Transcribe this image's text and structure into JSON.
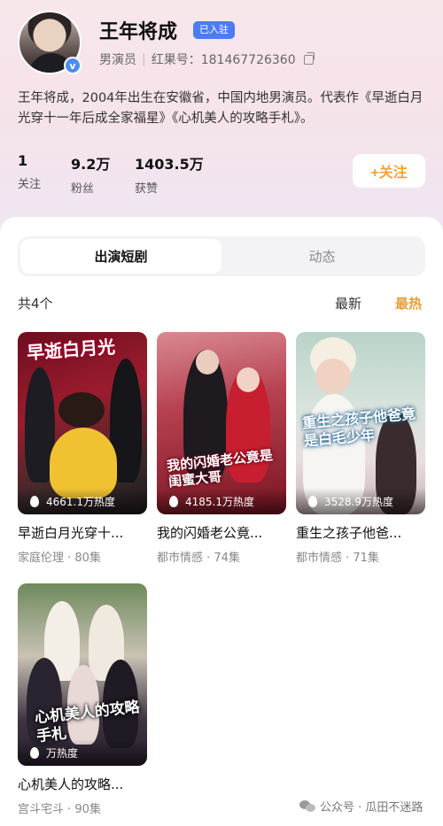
{
  "profile": {
    "name": "王年将成",
    "badge": "已入驻",
    "role": "男演员",
    "id_label": "红果号：181467726360",
    "bio": "王年将成，2004年出生在安徽省，中国内地男演员。代表作《早逝白月光穿十一年后成全家福星》《心机美人的攻略手札》。",
    "verified_mark": "v"
  },
  "stats": [
    {
      "value": "1",
      "label": "关注"
    },
    {
      "value": "9.2万",
      "label": "粉丝"
    },
    {
      "value": "1403.5万",
      "label": "获赞"
    }
  ],
  "follow_label": "+关注",
  "tabs": [
    {
      "label": "出演短剧",
      "active": true
    },
    {
      "label": "动态",
      "active": false
    }
  ],
  "list": {
    "count_label": "共4个",
    "sort_newest": "最新",
    "sort_hottest": "最热",
    "accent_color": "#e6a03c"
  },
  "dramas": [
    {
      "poster_text": "早逝白月光",
      "heat": "4661.1万热度",
      "title": "早逝白月光穿十...",
      "meta": "家庭伦理 · 80集"
    },
    {
      "poster_text": "我的闪婚老公竟是闺蜜大哥",
      "heat": "4185.1万热度",
      "title": "我的闪婚老公竟...",
      "meta": "都市情感 · 74集"
    },
    {
      "poster_text": "重生之孩子他爸竟是白毛少年",
      "heat": "3528.9万热度",
      "title": "重生之孩子他爸...",
      "meta": "都市情感 · 71集"
    },
    {
      "poster_text": "心机美人的攻略手札",
      "heat": "万热度",
      "title": "心机美人的攻略...",
      "meta": "宫斗宅斗 · 90集"
    }
  ],
  "watermark": "公众号 · 瓜田不迷路"
}
